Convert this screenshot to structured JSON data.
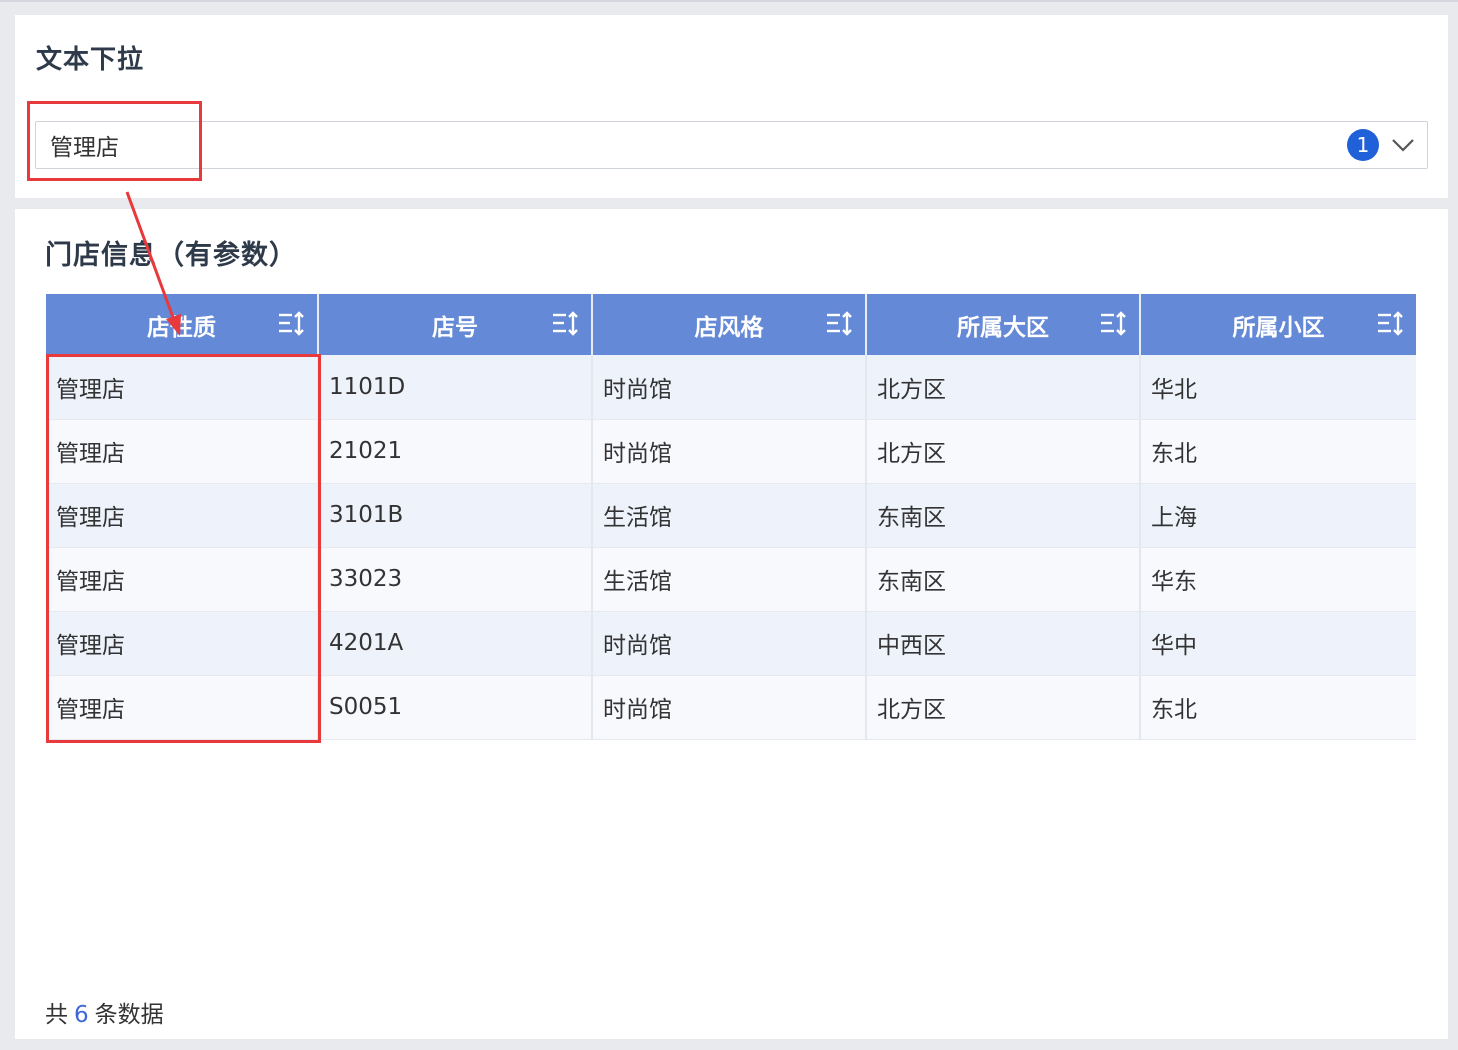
{
  "filter": {
    "title": "文本下拉",
    "selected_value": "管理店",
    "selected_count": "1"
  },
  "table": {
    "title": "门店信息（有参数）",
    "columns": [
      "店性质",
      "店号",
      "店风格",
      "所属大区",
      "所属小区"
    ],
    "rows": [
      [
        "管理店",
        "1101D",
        "时尚馆",
        "北方区",
        "华北"
      ],
      [
        "管理店",
        "21021",
        "时尚馆",
        "北方区",
        "东北"
      ],
      [
        "管理店",
        "3101B",
        "生活馆",
        "东南区",
        "上海"
      ],
      [
        "管理店",
        "33023",
        "生活馆",
        "东南区",
        "华东"
      ],
      [
        "管理店",
        "4201A",
        "时尚馆",
        "中西区",
        "华中"
      ],
      [
        "管理店",
        "S0051",
        "时尚馆",
        "北方区",
        "东北"
      ]
    ]
  },
  "footer": {
    "prefix": "共",
    "count": "6",
    "suffix": "条数据"
  },
  "colors": {
    "header_bg": "#6489d6",
    "badge_bg": "#2060d8",
    "annotation": "#e8393c",
    "count_text": "#3d67d6"
  },
  "icons": {
    "dropdown": "chevron-down-icon",
    "sort": "sort-icon"
  }
}
